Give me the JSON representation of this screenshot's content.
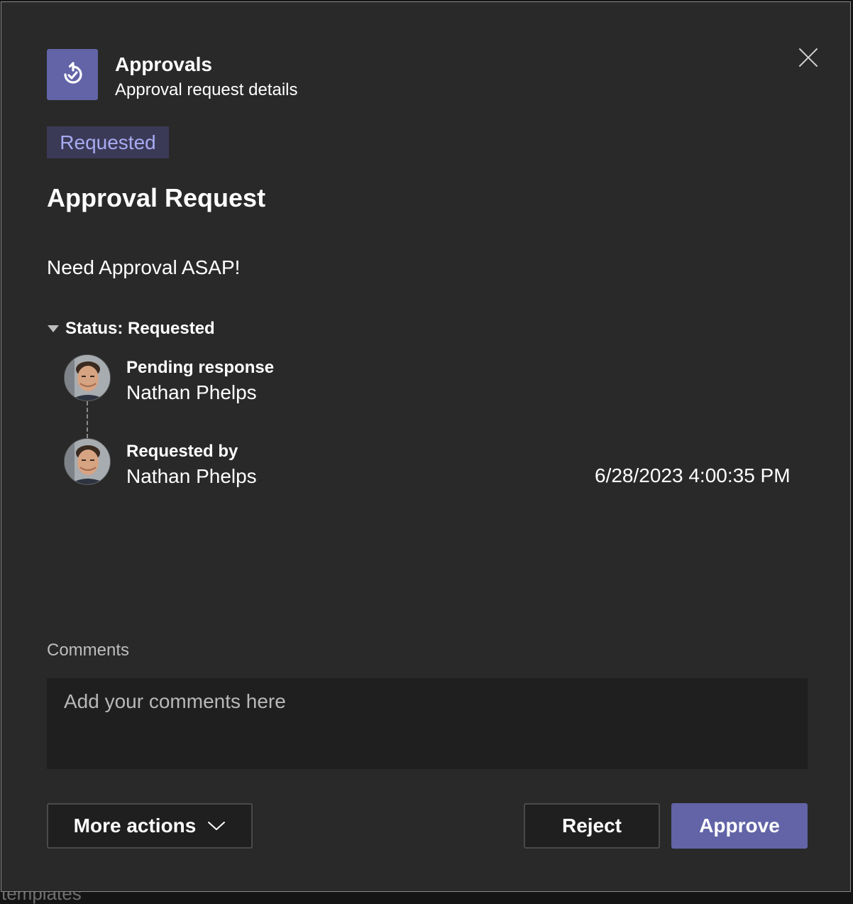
{
  "header": {
    "app_name": "Approvals",
    "subtitle": "Approval request details",
    "app_icon": "approvals-icon",
    "close_icon": "close-icon"
  },
  "status_badge": "Requested",
  "request": {
    "title": "Approval Request",
    "description": "Need Approval ASAP!"
  },
  "status_section": {
    "label": "Status: Requested",
    "toggle_icon": "triangle-down-icon",
    "entries": [
      {
        "label": "Pending response",
        "name": "Nathan Phelps",
        "timestamp": ""
      },
      {
        "label": "Requested by",
        "name": "Nathan Phelps",
        "timestamp": "6/28/2023 4:00:35 PM"
      }
    ]
  },
  "comments": {
    "label": "Comments",
    "placeholder": "Add your comments here",
    "value": ""
  },
  "actions": {
    "more_actions": "More actions",
    "more_actions_icon": "chevron-down-icon",
    "reject": "Reject",
    "approve": "Approve"
  },
  "background_text": "templates",
  "colors": {
    "accent": "#6264a7",
    "dialog_bg": "#292929",
    "badge_bg": "#3a3a57",
    "badge_text": "#a8aaf1"
  }
}
